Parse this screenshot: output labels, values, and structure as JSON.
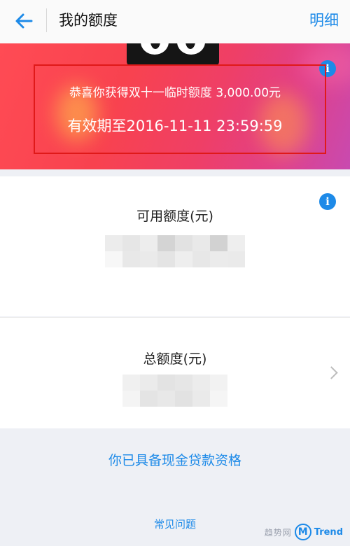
{
  "header": {
    "title": "我的额度",
    "detail_label": "明细"
  },
  "banner": {
    "line1": "恭喜你获得双十一临时额度 3,000.00元",
    "line2": "有效期至2016-11-11 23:59:59",
    "info_icon": "info-icon"
  },
  "available": {
    "label": "可用额度(元)",
    "value_obscured": true
  },
  "total": {
    "label": "总额度(元)",
    "value_obscured": true
  },
  "links": {
    "cash_loan": "你已具备现金贷款资格",
    "faq": "常见问题"
  },
  "watermark": {
    "cn": "趋势网",
    "logo_letter": "M",
    "brand": "Trend"
  },
  "colors": {
    "accent": "#1d8ae8",
    "highlight_border": "#e01919"
  }
}
